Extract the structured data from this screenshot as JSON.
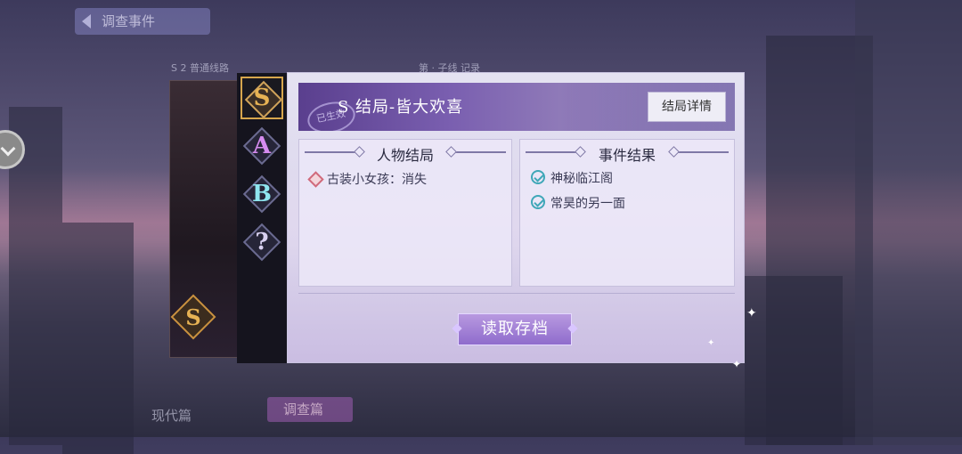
{
  "background": {
    "top_chip_label": "调查事件",
    "faint_text_1": "S 2 普通线路",
    "faint_text_2": "第 · 子线 记录",
    "bottom_left_text": "现代篇",
    "bottom_chip_label": "调查篇"
  },
  "tabs": [
    {
      "letter": "S",
      "color": "#e6b254",
      "active": true
    },
    {
      "letter": "A",
      "color": "#d68cf0",
      "active": false
    },
    {
      "letter": "B",
      "color": "#8fe6f0",
      "active": false
    },
    {
      "letter": "?",
      "color": "#d8d0f0",
      "active": false
    }
  ],
  "left_card_badge": "S",
  "panel": {
    "banner_title": "S 结局-皆大欢喜",
    "stamp_text": "已生效",
    "detail_button": "结局详情",
    "characters": {
      "heading": "人物结局",
      "items": [
        "古装小女孩：消失"
      ]
    },
    "events": {
      "heading": "事件结果",
      "items": [
        "神秘临江阁",
        "常昊的另一面"
      ]
    },
    "load_button": "读取存档"
  }
}
